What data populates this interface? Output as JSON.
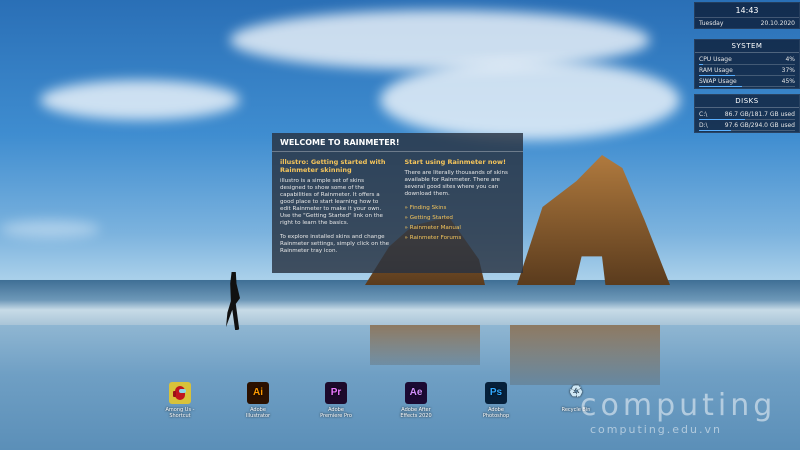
{
  "clock": {
    "time": "14:43",
    "day": "Tuesday",
    "date": "20.10.2020"
  },
  "system": {
    "title": "SYSTEM",
    "rows": [
      {
        "label": "CPU Usage",
        "value": "4%",
        "level": 0.04
      },
      {
        "label": "RAM Usage",
        "value": "37%",
        "level": 0.37
      },
      {
        "label": "SWAP Usage",
        "value": "45%",
        "level": 0.45
      }
    ]
  },
  "disks": {
    "title": "DISKS",
    "rows": [
      {
        "label": "C:\\",
        "value": "86.7 GB/181.7 GB used",
        "level": 0.477
      },
      {
        "label": "D:\\",
        "value": "97.6 GB/294.0 GB used",
        "level": 0.332
      }
    ]
  },
  "welcome": {
    "title": "WELCOME TO RAINMETER!",
    "left": {
      "heading": "illustro: Getting started with Rainmeter skinning",
      "p1": "illustro is a simple set of skins designed to show some of the capabilities of Rainmeter. It offers a good place to start learning how to edit Rainmeter to make it your own. Use the \"Getting Started\" link on the right to learn the basics.",
      "p2": "To explore installed skins and change Rainmeter settings, simply click on the Rainmeter tray icon."
    },
    "right": {
      "heading": "Start using Rainmeter now!",
      "p1": "There are literally thousands of skins available for Rainmeter. There are several good sites where you can download them.",
      "links": [
        "» Finding Skins",
        "» Getting Started",
        "» Rainmeter Manual",
        "» Rainmeter Forums"
      ]
    }
  },
  "icons": [
    {
      "label": "Among Us - Shortcut",
      "glyph": "",
      "bg": "#d8c23a",
      "fg": "#c0141e",
      "icon": "among-us-icon"
    },
    {
      "label": "Adobe Illustrator",
      "glyph": "Ai",
      "bg": "#2b1100",
      "fg": "#ff9a00",
      "icon": "illustrator-icon"
    },
    {
      "label": "Adobe Premiere Pro",
      "glyph": "Pr",
      "bg": "#1d0a2b",
      "fg": "#ea77ff",
      "icon": "premiere-icon"
    },
    {
      "label": "Adobe After Effects 2020",
      "glyph": "Ae",
      "bg": "#1b0a33",
      "fg": "#d291ff",
      "icon": "after-effects-icon"
    },
    {
      "label": "Adobe Photoshop",
      "glyph": "Ps",
      "bg": "#06203a",
      "fg": "#31a8ff",
      "icon": "photoshop-icon"
    },
    {
      "label": "Recycle Bin",
      "glyph": "♻",
      "bg": "transparent",
      "fg": "#cfe8f5",
      "icon": "recycle-bin-icon"
    }
  ],
  "watermark": {
    "brand": "computing",
    "site": "computing.edu.vn"
  }
}
